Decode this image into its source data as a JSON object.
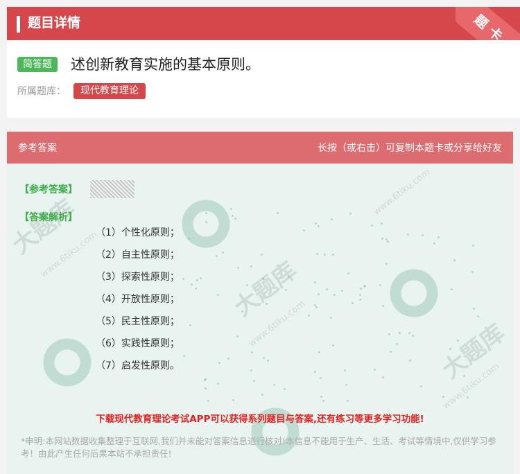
{
  "header": {
    "title": "题目详情",
    "corner_badge": "题卡"
  },
  "question": {
    "type_tag": "简答题",
    "text": "述创新教育实施的基本原则。",
    "library_label": "所属题库：",
    "library_tag": "现代教育理论"
  },
  "answer_card": {
    "header_left": "参考答案",
    "header_right": "长按（或右击）可复制本题卡或分享给好友",
    "reference_label": "【参考答案】",
    "analysis_label": "【答案解析】",
    "analysis_items": [
      "（1）个性化原则；",
      "（2）自主性原则；",
      "（3）探索性原则；",
      "（4）开放性原则；",
      "（5）民主性原则；",
      "（6）实践性原则；",
      "（7）启发性原则。"
    ],
    "promo": "下载现代教育理论考试APP可以获得系列题目与答案,还有练习等更多学习功能!",
    "disclaimer": "*申明:本网站数据收集整理于互联网,我们并未能对答案信息进行核对!本信息不能用于生产、生活、考试等情境中,仅供学习参考！由此产生任何后果本站不承担责任!"
  },
  "watermark": {
    "text": "大题库",
    "url": "www.6tiku.com"
  }
}
